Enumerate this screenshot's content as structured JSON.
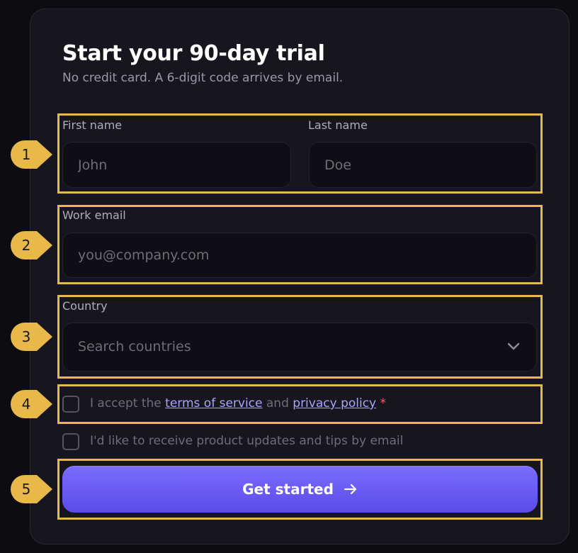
{
  "form": {
    "title": "Start your 90-day trial",
    "subtitle": "No credit card. A 6-digit code arrives by email.",
    "first_name": {
      "label": "First name",
      "placeholder": "John"
    },
    "last_name": {
      "label": "Last name",
      "placeholder": "Doe"
    },
    "email": {
      "label": "Work email",
      "placeholder": "you@company.com"
    },
    "country": {
      "label": "Country",
      "placeholder": "Search countries"
    },
    "terms": {
      "prefix": "I accept the",
      "terms_link": "terms of service",
      "middle": "and",
      "privacy_link": "privacy policy",
      "required_mark": "*"
    },
    "updates": {
      "label": "I'd like to receive product updates and tips by email"
    },
    "submit_label": "Get started"
  },
  "markers": [
    "1",
    "2",
    "3",
    "4",
    "5"
  ],
  "colors": {
    "background": "#0d0c11",
    "card": "#17161e",
    "accent": "#6a5cf5",
    "link": "#a9a4ff",
    "required": "#ff5a6e",
    "highlight": "#e8b94a"
  },
  "icons": {
    "select": "chevron-down-icon",
    "submit": "arrow-right-icon"
  }
}
